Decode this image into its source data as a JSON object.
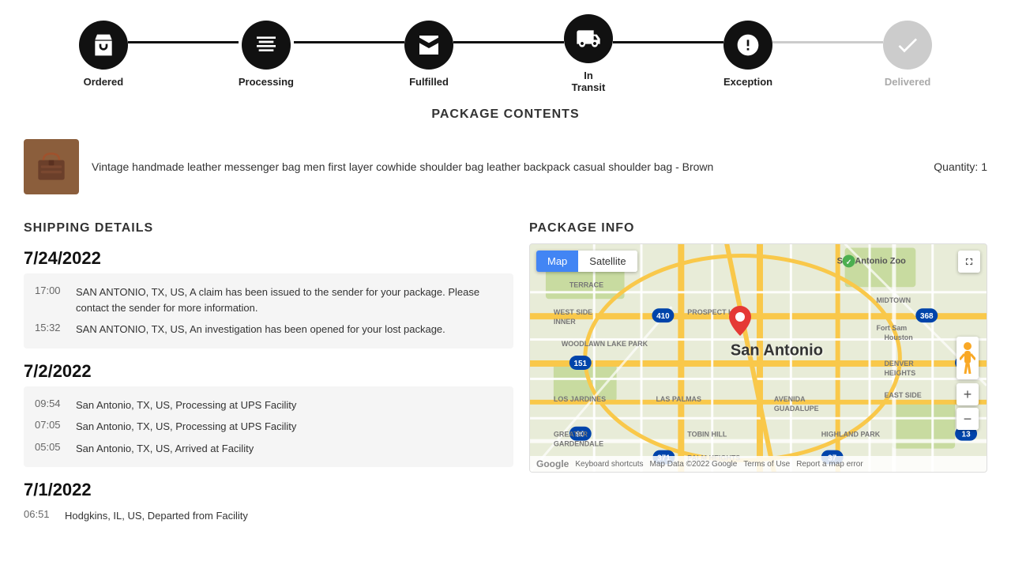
{
  "status": {
    "steps": [
      {
        "id": "ordered",
        "label": "Ordered",
        "active": true
      },
      {
        "id": "processing",
        "label": "Processing",
        "active": true
      },
      {
        "id": "fulfilled",
        "label": "Fulfilled",
        "active": true
      },
      {
        "id": "in-transit",
        "label": "In\nTransit",
        "active": true
      },
      {
        "id": "exception",
        "label": "Exception",
        "active": true
      },
      {
        "id": "delivered",
        "label": "Delivered",
        "active": false
      }
    ]
  },
  "package_contents": {
    "title": "PACKAGE CONTENTS",
    "item": {
      "description": "Vintage handmade leather messenger bag men first layer cowhide shoulder bag leather backpack casual shoulder bag - Brown",
      "quantity_label": "Quantity: 1"
    }
  },
  "shipping_details": {
    "title": "SHIPPING DETAILS",
    "date_groups": [
      {
        "date": "7/24/2022",
        "events": [
          {
            "time": "17:00",
            "description": "SAN ANTONIO, TX, US, A claim has been issued to the sender for your package. Please contact the sender for more information."
          },
          {
            "time": "15:32",
            "description": "SAN ANTONIO, TX, US, An investigation has been opened for your lost package."
          }
        ],
        "highlighted": true
      },
      {
        "date": "7/2/2022",
        "events": [
          {
            "time": "09:54",
            "description": "San Antonio, TX, US, Processing at UPS Facility"
          },
          {
            "time": "07:05",
            "description": "San Antonio, TX, US, Processing at UPS Facility"
          },
          {
            "time": "05:05",
            "description": "San Antonio, TX, US, Arrived at Facility"
          }
        ],
        "highlighted": false
      },
      {
        "date": "7/1/2022",
        "events": [
          {
            "time": "06:51",
            "description": "Hodgkins, IL, US, Departed from Facility"
          }
        ],
        "highlighted": false
      }
    ]
  },
  "package_info": {
    "title": "PACKAGE INFO",
    "map": {
      "map_btn": "Map",
      "satellite_btn": "Satellite",
      "city_label": "San Antonio",
      "footer": {
        "google": "Google",
        "keyboard_shortcuts": "Keyboard shortcuts",
        "map_data": "Map Data ©2022 Google",
        "terms": "Terms of Use",
        "report": "Report a map error"
      }
    }
  }
}
